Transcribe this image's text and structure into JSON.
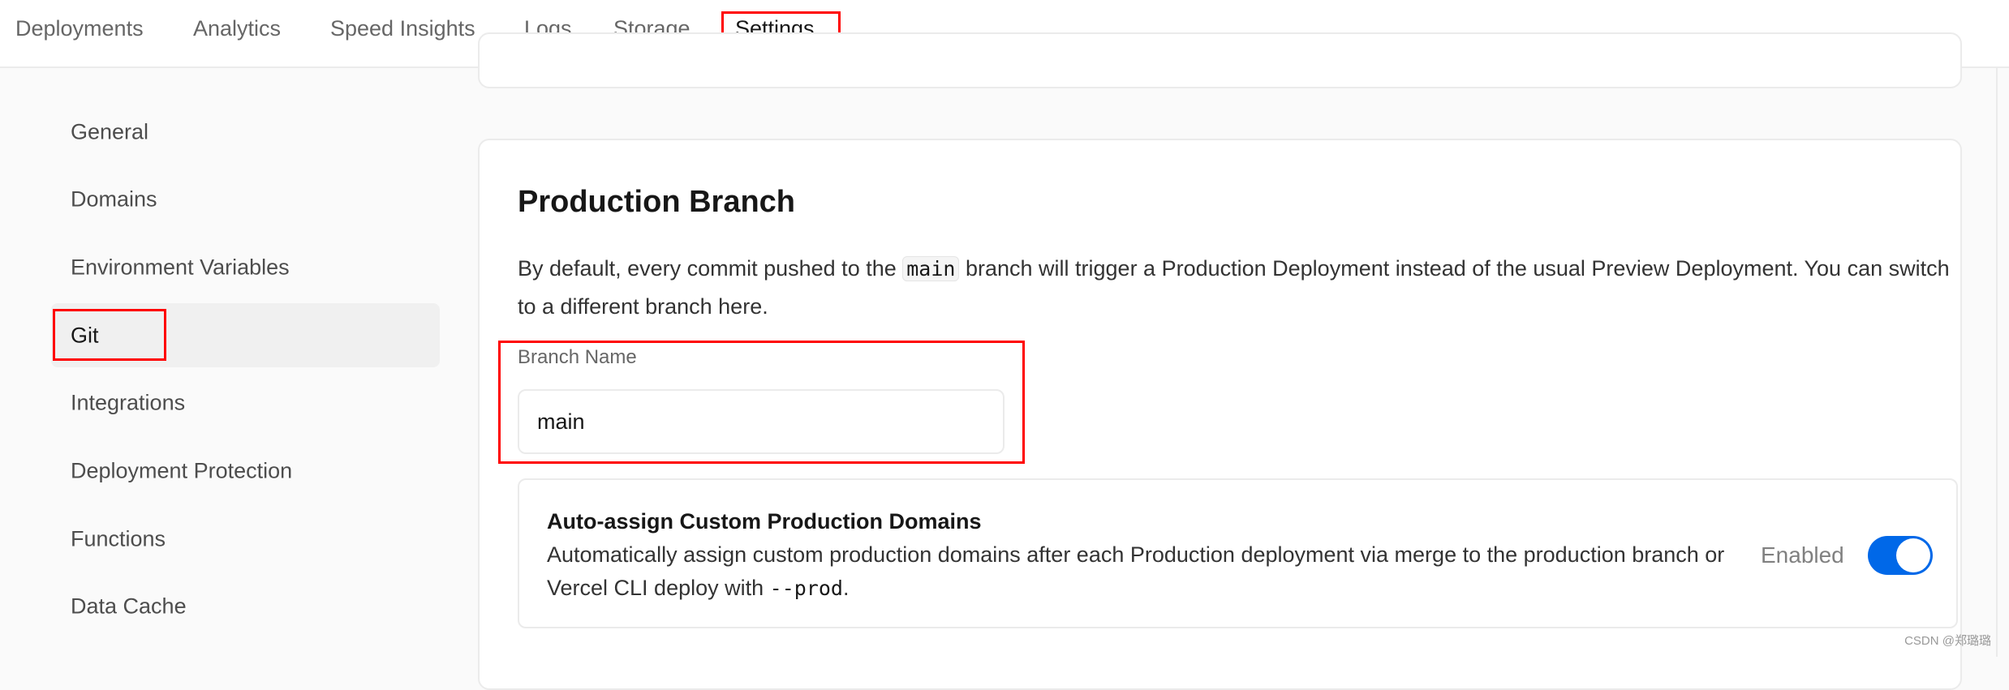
{
  "nav": {
    "tabs": [
      {
        "label": "Deployments"
      },
      {
        "label": "Analytics"
      },
      {
        "label": "Speed Insights"
      },
      {
        "label": "Logs"
      },
      {
        "label": "Storage"
      },
      {
        "label": "Settings",
        "active": true
      }
    ]
  },
  "sidebar": {
    "items": [
      {
        "label": "General"
      },
      {
        "label": "Domains"
      },
      {
        "label": "Environment Variables"
      },
      {
        "label": "Git",
        "active": true
      },
      {
        "label": "Integrations"
      },
      {
        "label": "Deployment Protection"
      },
      {
        "label": "Functions"
      },
      {
        "label": "Data Cache"
      }
    ]
  },
  "production_branch": {
    "title": "Production Branch",
    "desc_before": "By default, every commit pushed to the ",
    "desc_code": "main",
    "desc_after": " branch will trigger a Production Deployment instead of the usual Preview Deployment. You can switch to a different branch here.",
    "field_label": "Branch Name",
    "field_value": "main"
  },
  "auto_assign": {
    "title": "Auto-assign Custom Production Domains",
    "desc_before": "Automatically assign custom production domains after each Production deployment via merge to the production branch or Vercel CLI deploy with ",
    "desc_code": "--prod",
    "desc_after": ".",
    "status": "Enabled",
    "toggle_on": true
  },
  "colors": {
    "accent": "#0068e8",
    "highlight": "#ff0000"
  },
  "watermark": "CSDN @郑璐璐"
}
